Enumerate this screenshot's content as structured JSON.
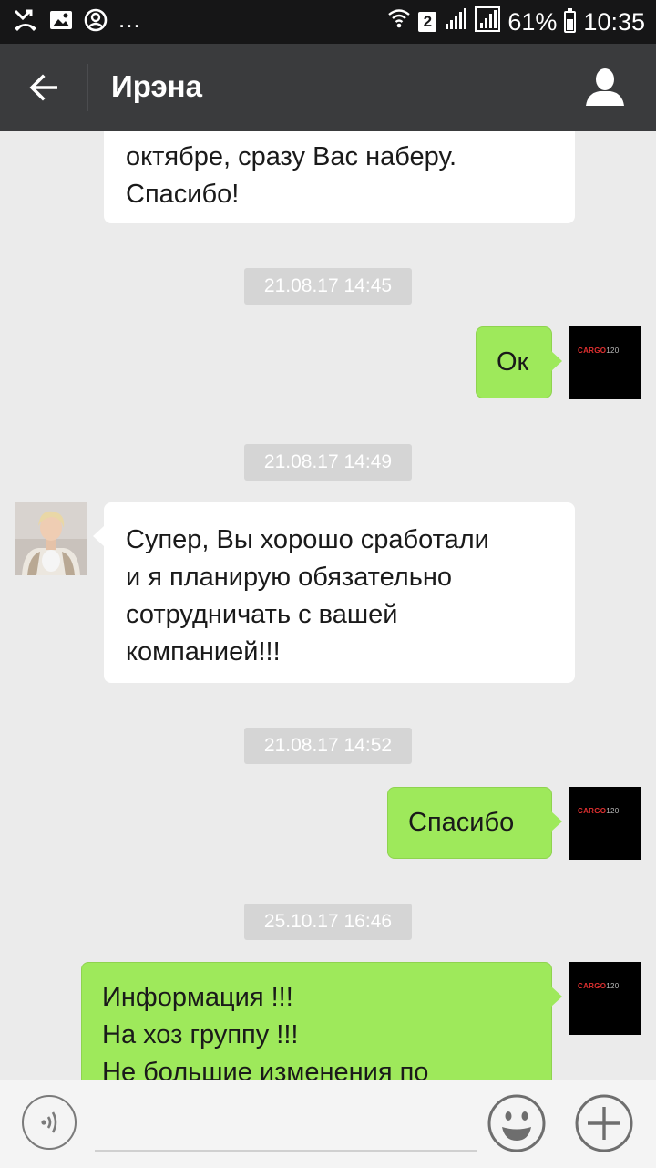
{
  "status_bar": {
    "dots": "...",
    "sim_badge": "2",
    "battery_percent": "61%",
    "time": "10:35",
    "icons": [
      "missed-call-icon",
      "image-icon",
      "account-icon",
      "wifi-icon",
      "signal-icon",
      "battery-icon"
    ]
  },
  "header": {
    "title": "Ирэна",
    "icons": [
      "back-arrow-icon",
      "profile-icon"
    ]
  },
  "messages": [
    {
      "type": "in",
      "text": "октябре, сразу Вас наберу.\nСпасибо!"
    },
    {
      "type": "timestamp",
      "text": "21.08.17 14:45"
    },
    {
      "type": "out",
      "text": "Ок",
      "avatar_label": "CARGO120"
    },
    {
      "type": "timestamp",
      "text": "21.08.17 14:49"
    },
    {
      "type": "in",
      "text": "Супер, Вы хорошо сработали\nи я планирую обязательно\nсотрудничать с вашей\nкомпанией!!!"
    },
    {
      "type": "timestamp",
      "text": "21.08.17 14:52"
    },
    {
      "type": "out",
      "text": "Спасибо",
      "avatar_label": "CARGO120"
    },
    {
      "type": "timestamp",
      "text": "25.10.17 16:46"
    },
    {
      "type": "out",
      "text": "Информация !!!\nНа хоз группу !!!\nНе большие изменения по",
      "avatar_label": "CARGO120"
    }
  ],
  "input_bar": {
    "placeholder": "",
    "icons": [
      "voice-icon",
      "emoji-icon",
      "plus-icon"
    ]
  },
  "colors": {
    "status_bar_bg": "#161617",
    "title_bar_bg": "#3a3b3d",
    "chat_bg": "#ebebeb",
    "outgoing_bubble": "#9ee95b",
    "incoming_bubble": "#ffffff",
    "timestamp_bg": "#d5d5d5"
  }
}
